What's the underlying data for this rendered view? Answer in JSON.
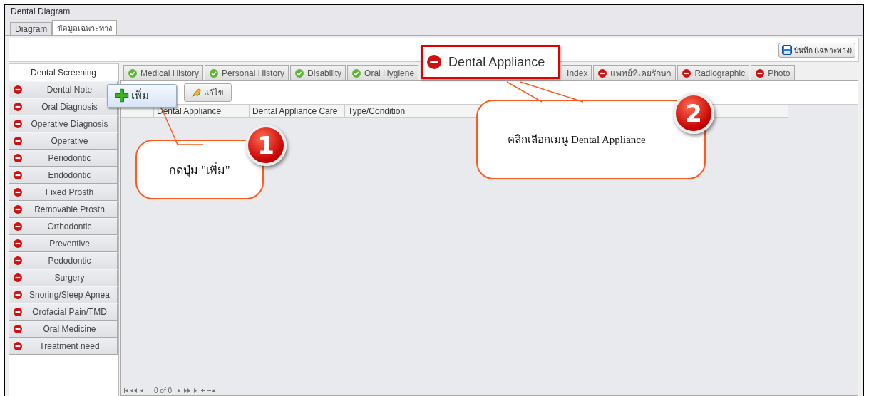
{
  "window": {
    "title": "Dental Diagram"
  },
  "tabs": [
    {
      "label": "Diagram",
      "selected": false
    },
    {
      "label": "ข้อมูลเฉพาะทาง",
      "selected": true
    }
  ],
  "save_button": {
    "label": "บันทึก (เฉพาะทาง)"
  },
  "sidebar": {
    "header": "Dental Screening",
    "items": [
      {
        "label": "Dental Note",
        "done": false
      },
      {
        "label": "Oral Diagnosis",
        "done": false
      },
      {
        "label": "Operative Diagnosis",
        "done": false
      },
      {
        "label": "Operative",
        "done": false
      },
      {
        "label": "Periodontic",
        "done": false
      },
      {
        "label": "Endodontic",
        "done": false
      },
      {
        "label": "Fixed Prosth",
        "done": false
      },
      {
        "label": "Removable Prosth",
        "done": false
      },
      {
        "label": "Orthodontic",
        "done": false
      },
      {
        "label": "Preventive",
        "done": false
      },
      {
        "label": "Pedodontic",
        "done": false
      },
      {
        "label": "Surgery",
        "done": false
      },
      {
        "label": "Snoring/Sleep Apnea",
        "done": false
      },
      {
        "label": "Orofacial Pain/TMD",
        "done": false
      },
      {
        "label": "Oral Medicine",
        "done": false
      },
      {
        "label": "Treatment need",
        "done": false
      }
    ]
  },
  "subtabs": [
    {
      "label": "Medical History",
      "done": true,
      "selected": false,
      "highlighted": false
    },
    {
      "label": "Personal History",
      "done": true,
      "selected": false,
      "highlighted": false
    },
    {
      "label": "Disability",
      "done": true,
      "selected": false,
      "highlighted": false
    },
    {
      "label": "Oral Hygiene",
      "done": true,
      "selected": false,
      "highlighted": false
    },
    {
      "label": "Dental Appliance",
      "done": false,
      "selected": true,
      "highlighted": true
    },
    {
      "label": "Index",
      "selected": false,
      "highlighted": false
    },
    {
      "label": "แพทย์ที่เคยรักษา",
      "done": false,
      "selected": false,
      "highlighted": false
    },
    {
      "label": "Radiographic",
      "done": false,
      "selected": false,
      "highlighted": false
    },
    {
      "label": "Photo",
      "done": false,
      "selected": false,
      "highlighted": false
    }
  ],
  "toolbar": [
    {
      "kind": "add",
      "label": "เพิ่ม",
      "highlighted": true
    },
    {
      "kind": "edit",
      "label": "แก้ไข",
      "highlighted": false
    }
  ],
  "table": {
    "columns": [
      "",
      "Dental Appliance",
      "Dental Appliance Care",
      "Type/Condition",
      ""
    ]
  },
  "navigator": {
    "position": "0 of 0"
  },
  "callouts": [
    {
      "number": "1",
      "text": "กดปุ่ม \"เพิ่ม\"",
      "kind": "button"
    },
    {
      "number": "2",
      "text": "คลิกเลือกเมนู Dental Appliance",
      "kind": "tab"
    }
  ]
}
